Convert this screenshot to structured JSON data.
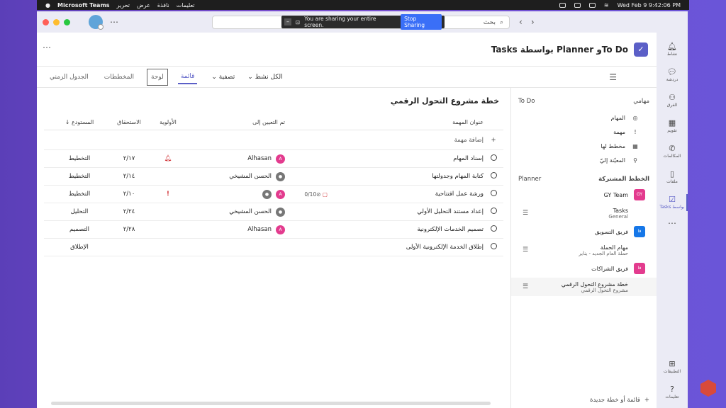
{
  "menubar": {
    "app_name": "Microsoft Teams",
    "menus": [
      "تحرير",
      "عرض",
      "نافذة",
      "تعليمات"
    ],
    "clock": "Wed Feb 9  9:42:06 PM"
  },
  "titlebar": {
    "search_placeholder": "بحث",
    "share_text": "You are sharing your entire screen.",
    "stop_sharing": "Stop Sharing"
  },
  "rail": {
    "items": [
      {
        "label": "نشاط",
        "icon": "bell-icon"
      },
      {
        "label": "دردشة",
        "icon": "chat-icon"
      },
      {
        "label": "الفرق",
        "icon": "teams-icon"
      },
      {
        "label": "تقويم",
        "icon": "calendar-icon"
      },
      {
        "label": "المكالمات",
        "icon": "phone-icon"
      },
      {
        "label": "ملفات",
        "icon": "file-icon"
      },
      {
        "label": "Tasks بواسط",
        "icon": "tasks-icon"
      }
    ],
    "apps": "التطبيقات",
    "help": "تعليمات"
  },
  "header": {
    "title": "Tasks بواسطة Planner وTo Do"
  },
  "toolbar": {
    "views": [
      "الجدول الزمني",
      "المخططات",
      "لوحة",
      "قائمة"
    ],
    "filter": "تصفية",
    "scope": "الكل نشط"
  },
  "sidebar": {
    "mytasks_title": "مهامي",
    "mytasks_source": "To Do",
    "mytasks_items": [
      {
        "label": "المهام",
        "icon": "check-circle-icon"
      },
      {
        "label": "مهمة",
        "icon": "exclamation-icon"
      },
      {
        "label": "مخطط لها",
        "icon": "calendar-icon"
      },
      {
        "label": "المعيّنة إليّ",
        "icon": "person-icon"
      }
    ],
    "shared_title": "الخطط المشتركة",
    "shared_source": "Planner",
    "plans": [
      {
        "name": "GY Team",
        "sub": "",
        "badge": "GY",
        "color": "#e33b8e",
        "list": false
      },
      {
        "name": "Tasks",
        "sub": "General",
        "badge": "",
        "color": "",
        "list": true
      },
      {
        "name": "فريق التسويق",
        "sub": "",
        "badge": "فا",
        "color": "#1677e8",
        "list": false
      },
      {
        "name": "مهام الحملة",
        "sub": "حملة العام الجديد - يناير",
        "badge": "",
        "color": "",
        "list": true
      },
      {
        "name": "فريق الشراكات",
        "sub": "",
        "badge": "فا",
        "color": "#e33b8e",
        "list": false
      },
      {
        "name": "خطة مشروع التحول الرقمي",
        "sub": "مشروع التحول الرقمي",
        "badge": "",
        "color": "",
        "list": true
      }
    ],
    "new_plan": "قائمة أو خطة جديدة"
  },
  "main": {
    "plan_title": "خطة مشروع التحول الرقمي",
    "columns": {
      "title": "عنوان المهمة",
      "assigned": "تم التعيين إلى",
      "priority": "الأولوية",
      "due": "الاستحقاق",
      "bucket": "المستودع ↓"
    },
    "add_task": "إضافة مهمة",
    "rows": [
      {
        "title": "إسناد المهام",
        "progress": "",
        "assignees": [
          "A"
        ],
        "assignee_name": "Alhasan",
        "priority": "bell",
        "due": "٢/١٧",
        "bucket": "التخطيط"
      },
      {
        "title": "كتابة المهام وجدولتها",
        "progress": "",
        "assignees": [
          "G"
        ],
        "assignee_name": "الحسن المشيخي",
        "priority": "",
        "due": "٢/١٤",
        "bucket": "التخطيط"
      },
      {
        "title": "ورشة عمل افتتاحية",
        "progress": "0/10",
        "assignees": [
          "A",
          "G"
        ],
        "assignee_name": "",
        "priority": "!",
        "due": "٢/١٠",
        "bucket": "التخطيط"
      },
      {
        "title": "إعداد مستند التحليل الأولي",
        "progress": "",
        "assignees": [
          "G"
        ],
        "assignee_name": "الحسن المشيخي",
        "priority": "",
        "due": "٢/٢٤",
        "bucket": "التحليل"
      },
      {
        "title": "تصميم الخدمات الإلكترونية",
        "progress": "",
        "assignees": [
          "A"
        ],
        "assignee_name": "Alhasan",
        "priority": "",
        "due": "٢/٢٨",
        "bucket": "التصميم"
      },
      {
        "title": "إطلاق الخدمة الإلكترونية الأولى",
        "progress": "",
        "assignees": [],
        "assignee_name": "",
        "priority": "",
        "due": "",
        "bucket": "الإطلاق"
      }
    ]
  }
}
